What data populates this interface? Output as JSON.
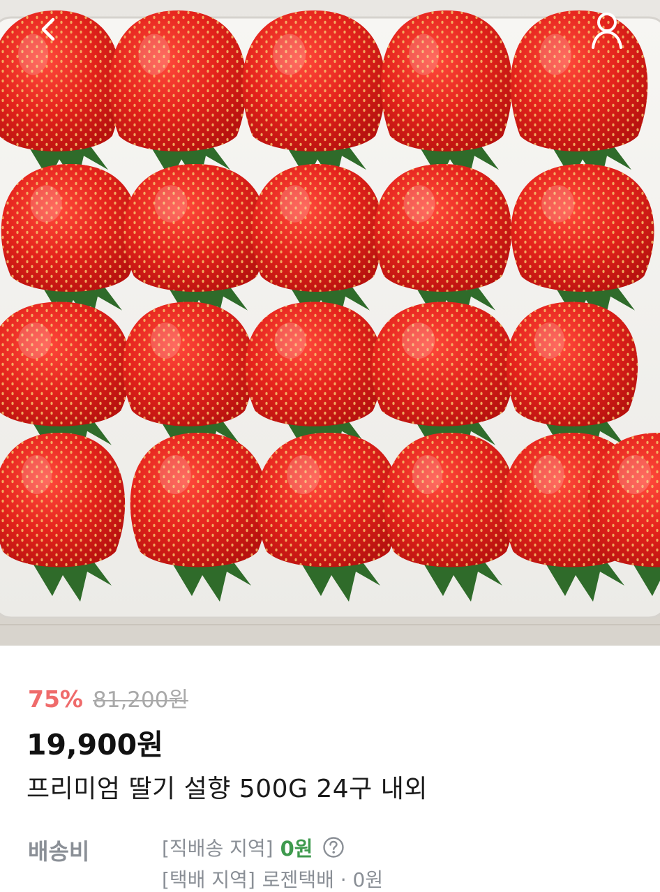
{
  "header": {
    "back_icon": "chevron-left-icon",
    "profile_icon": "user-icon"
  },
  "product": {
    "discount": "75%",
    "original_price": "81,200원",
    "sale_price": "19,900원",
    "name": "프리미엄 딸기 설향 500G 24구 내외"
  },
  "shipping": {
    "label": "배송비",
    "direct": {
      "region": "[직배송 지역]",
      "fee": "0원",
      "help_icon": "question-circle-icon"
    },
    "courier": {
      "region": "[택배 지역]",
      "detail": "로젠택배 · 0원"
    }
  },
  "colors": {
    "discount": "#ef6b6b",
    "free_fee": "#3f9a4e",
    "muted": "#8a8f96",
    "strawberry": "#e4231c"
  }
}
